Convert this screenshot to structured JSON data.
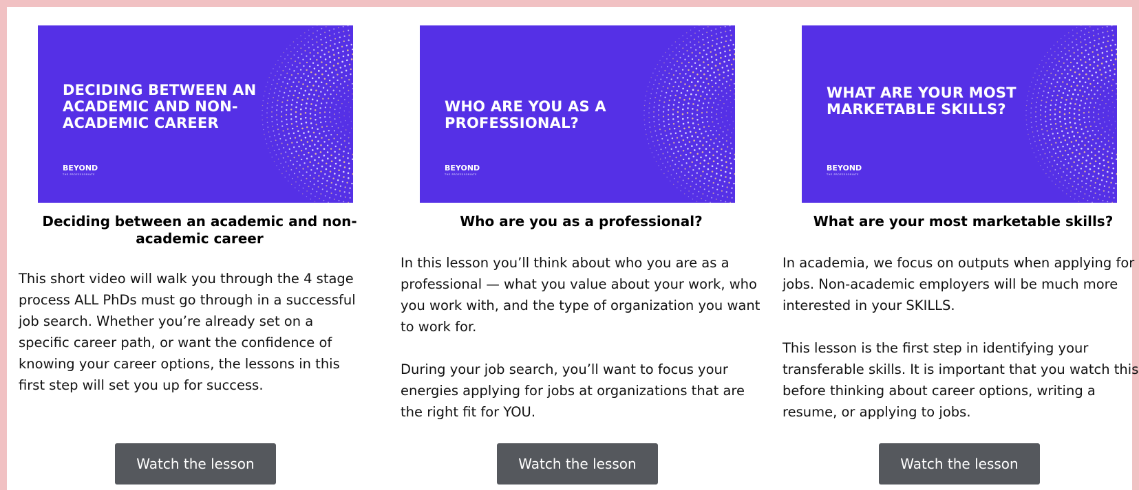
{
  "colors": {
    "frame_border": "#f1c1c3",
    "thumbnail_bg": "#5530e6",
    "button_bg": "#55585d",
    "button_text": "#ffffff"
  },
  "cards": [
    {
      "thumb_title": "DECIDING BETWEEN AN ACADEMIC AND NON-ACADEMIC CAREER",
      "brand_name": "BEYOND",
      "brand_sub": "THE PROFESSORIATE",
      "heading": "Deciding between an academic and non-academic career",
      "paragraphs": [
        "This short video will walk you through the 4 stage process ALL PhDs must go through in a successful job search. Whether you’re already set on a specific career path, or want the confidence of knowing your career options, the lessons in this first step will set you up for success."
      ],
      "button_label": "Watch the lesson"
    },
    {
      "thumb_title": "WHO ARE YOU AS A PROFESSIONAL?",
      "brand_name": "BEYOND",
      "brand_sub": "THE PROFESSORIATE",
      "heading": "Who are you as a professional?",
      "paragraphs": [
        "In this lesson you’ll think about who you are as a professional — what you value about your work, who you work with, and the type of organization you want to work for.",
        "During your job search, you’ll want to focus your energies applying for jobs at organizations that are the right fit for YOU."
      ],
      "button_label": "Watch the lesson"
    },
    {
      "thumb_title": "WHAT ARE YOUR MOST MARKETABLE SKILLS?",
      "brand_name": "BEYOND",
      "brand_sub": "THE PROFESSORIATE",
      "heading": "What are your most marketable skills?",
      "paragraphs": [
        "In academia, we focus on outputs when applying for jobs. Non-academic employers will be much more interested in your SKILLS.",
        "This lesson is the first step in identifying your transferable skills. It is important that you watch this before thinking about career options, writing a resume, or applying to jobs."
      ],
      "button_label": "Watch the lesson"
    }
  ]
}
